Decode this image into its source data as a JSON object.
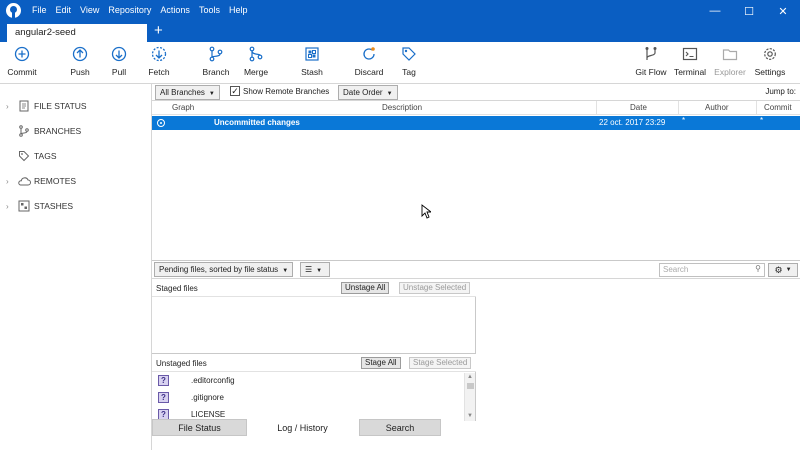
{
  "menu": [
    "File",
    "Edit",
    "View",
    "Repository",
    "Actions",
    "Tools",
    "Help"
  ],
  "window_controls": {
    "minimize": "—",
    "maximize": "☐",
    "close": "✕"
  },
  "tab": {
    "label": "angular2-seed",
    "add": "+"
  },
  "toolbar": {
    "commit": "Commit",
    "push": "Push",
    "pull": "Pull",
    "fetch": "Fetch",
    "branch": "Branch",
    "merge": "Merge",
    "stash": "Stash",
    "discard": "Discard",
    "tag": "Tag",
    "gitflow": "Git Flow",
    "terminal": "Terminal",
    "explorer": "Explorer",
    "settings": "Settings"
  },
  "sidebar": {
    "file_status": "FILE STATUS",
    "branches": "BRANCHES",
    "tags": "TAGS",
    "remotes": "REMOTES",
    "stashes": "STASHES"
  },
  "filters": {
    "branches": "All Branches",
    "show_remote": "Show Remote Branches",
    "order": "Date Order",
    "jump_to": "Jump to:"
  },
  "log_columns": {
    "graph": "Graph",
    "description": "Description",
    "date": "Date",
    "author": "Author",
    "commit": "Commit"
  },
  "log_rows": [
    {
      "description": "Uncommitted changes",
      "date": "22 oct. 2017 23:29",
      "author": "*",
      "commit": "*"
    }
  ],
  "file_pane": {
    "sort": "Pending files, sorted by file status",
    "search_placeholder": "Search",
    "staged_title": "Staged files",
    "unstage_all": "Unstage All",
    "unstage_selected": "Unstage Selected",
    "unstaged_title": "Unstaged files",
    "stage_all": "Stage All",
    "stage_selected": "Stage Selected",
    "unstaged_files": [
      ".editorconfig",
      ".gitignore",
      "LICENSE"
    ],
    "file_status_icon": "?"
  },
  "bottom_tabs": {
    "file_status": "File Status",
    "log_history": "Log / History",
    "search": "Search"
  },
  "colors": {
    "brand": "#0a5ec2",
    "selection": "#0a78d7",
    "discard_accent": "#e88a1a"
  }
}
